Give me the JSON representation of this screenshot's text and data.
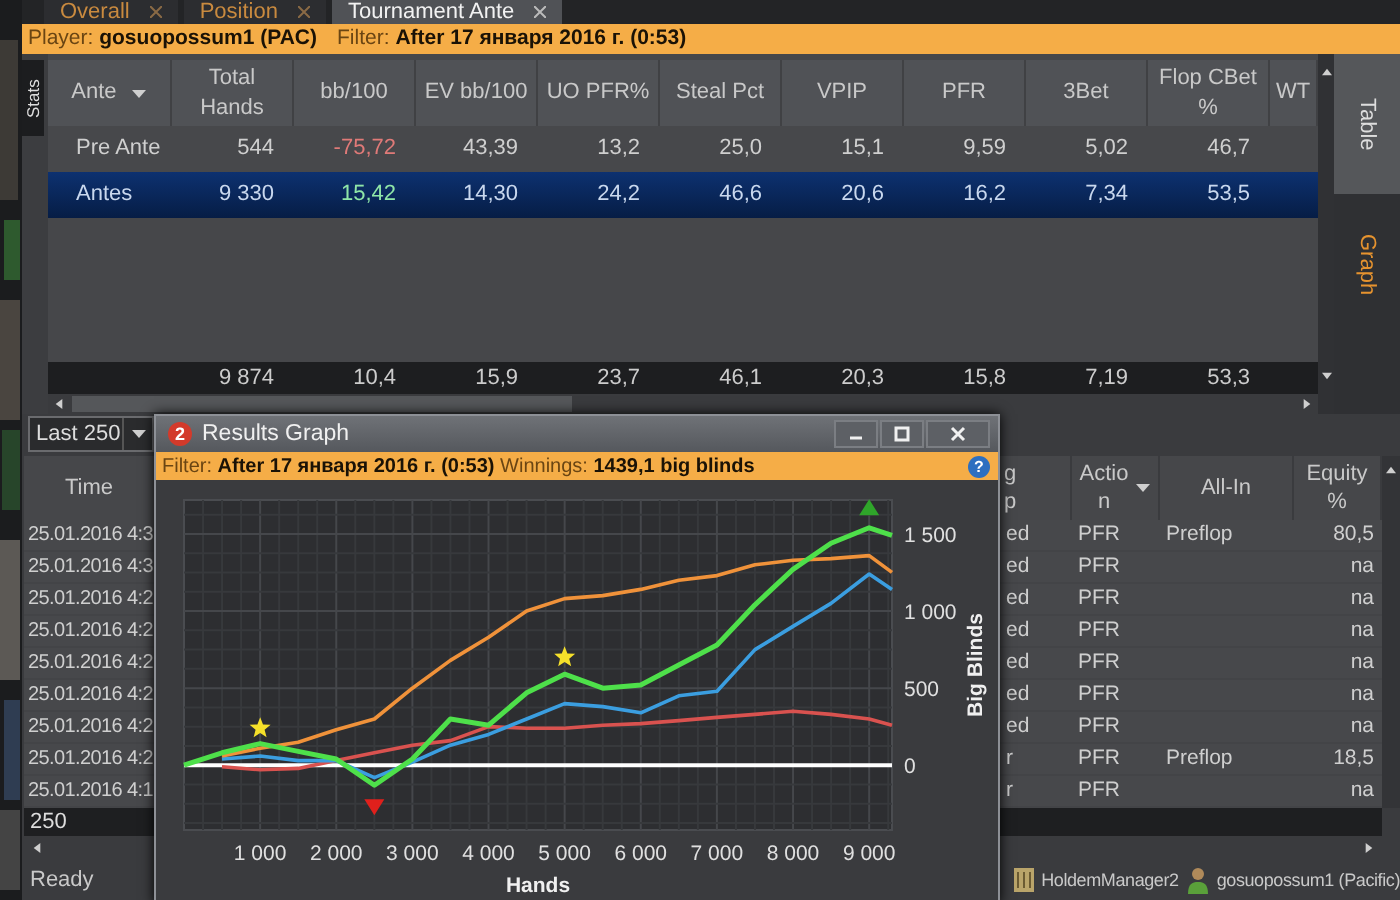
{
  "tabs": [
    {
      "label": "Overall",
      "selected": false
    },
    {
      "label": "Position",
      "selected": false
    },
    {
      "label": "Tournament Ante",
      "selected": true
    }
  ],
  "filter_bar": {
    "player": "Player: **gosuopossum1 (PAC)**",
    "filter": "Filter: **After 17 января 2016 г. (0:53)**"
  },
  "stats_tab": "Stats",
  "stats_table": {
    "columns": [
      {
        "label": "Ante",
        "dropdown": true
      },
      {
        "label": "Total\nHands",
        "dropdown": false
      },
      {
        "label": "bb/100",
        "dropdown": false
      },
      {
        "label": "EV bb/100",
        "dropdown": false
      },
      {
        "label": "UO PFR%",
        "dropdown": false
      },
      {
        "label": "Steal Pct",
        "dropdown": false
      },
      {
        "label": "VPIP",
        "dropdown": false
      },
      {
        "label": "PFR",
        "dropdown": false
      },
      {
        "label": "3Bet",
        "dropdown": false
      },
      {
        "label": "Flop CBet\n%",
        "dropdown": false
      },
      {
        "label": "WT",
        "dropdown": false
      }
    ],
    "rows": [
      {
        "cells": [
          "Pre Ante",
          "544",
          "-75,72",
          "43,39",
          "13,2",
          "25,0",
          "15,1",
          "9,59",
          "5,02",
          "46,7"
        ],
        "selected": false,
        "bb_negative": true
      },
      {
        "cells": [
          "Antes",
          "9 330",
          "15,42",
          "14,30",
          "24,2",
          "46,6",
          "20,6",
          "16,2",
          "7,34",
          "53,5"
        ],
        "selected": true,
        "bb_negative": false
      }
    ],
    "totals": [
      "9 874",
      "10,4",
      "15,9",
      "23,7",
      "46,1",
      "20,3",
      "15,8",
      "7,19",
      "53,3"
    ]
  },
  "side_tabs": [
    {
      "label": "Table",
      "selected": false
    },
    {
      "label": "Graph",
      "selected": true
    }
  ],
  "hands_filter": {
    "value": "Last 250"
  },
  "hands_table": {
    "columns": [
      {
        "label": "Time",
        "dropdown": false
      },
      {
        "label": "g\np",
        "dropdown": false
      },
      {
        "label": "Actio\nn",
        "dropdown": true
      },
      {
        "label": "All-In",
        "dropdown": false
      },
      {
        "label": "Equity\n%",
        "dropdown": false
      }
    ],
    "rows": [
      {
        "time": "25.01.2016 4:3",
        "column_2": "ed",
        "action": "PFR",
        "all_in": "Preflop",
        "equity": "80,5"
      },
      {
        "time": "25.01.2016 4:3",
        "column_2": "ed",
        "action": "PFR",
        "equity": "na"
      },
      {
        "time": "25.01.2016 4:2",
        "column_2": "ed",
        "action": "PFR",
        "equity": "na"
      },
      {
        "time": "25.01.2016 4:2",
        "column_2": "ed",
        "action": "PFR",
        "equity": "na"
      },
      {
        "time": "25.01.2016 4:2",
        "column_2": "ed",
        "action": "PFR",
        "equity": "na"
      },
      {
        "time": "25.01.2016 4:2",
        "column_2": "ed",
        "action": "PFR",
        "equity": "na"
      },
      {
        "time": "25.01.2016 4:2",
        "column_2": "ed",
        "action": "PFR",
        "equity": "na"
      },
      {
        "time": "25.01.2016 4:2",
        "column_2": "r",
        "action": "PFR",
        "all_in": "Preflop",
        "equity": "18,5"
      },
      {
        "time": "25.01.2016 4:1",
        "column_2": "r",
        "action": "PFR",
        "equity": "na"
      }
    ],
    "footer_count": "250"
  },
  "status_bar": {
    "text": "Ready",
    "app": "HoldemManager2",
    "player": "gosuopossum1 (Pacific)"
  },
  "graph_window": {
    "badge": "2",
    "title": "Results Graph",
    "info": "Filter: **After 17 января 2016 г. (0:53)** Winnings: **1439,1 big blinds**",
    "help": "?",
    "chart_data": {
      "type": "line",
      "grid": true,
      "xlabel": "Hands",
      "ylabel": "Big Blinds",
      "x": [
        0,
        500,
        1000,
        1500,
        2000,
        2500,
        3000,
        3500,
        4000,
        4500,
        5000,
        5500,
        6000,
        6500,
        7000,
        7500,
        8000,
        8500,
        9000,
        9300
      ],
      "series": [
        {
          "color": "#4ee04a",
          "values": [
            0,
            80,
            140,
            90,
            40,
            -130,
            40,
            300,
            260,
            470,
            590,
            500,
            520,
            650,
            780,
            1040,
            1270,
            1440,
            1540,
            1490
          ]
        },
        {
          "color": "#f0923a",
          "values": [
            null,
            60,
            110,
            150,
            230,
            300,
            500,
            680,
            830,
            1000,
            1080,
            1100,
            1140,
            1200,
            1230,
            1300,
            1330,
            1340,
            1360,
            1250
          ]
        },
        {
          "color": "#3b9ee0",
          "values": [
            null,
            40,
            60,
            30,
            30,
            -80,
            20,
            130,
            200,
            300,
            400,
            380,
            340,
            450,
            480,
            750,
            900,
            1050,
            1240,
            1140
          ]
        },
        {
          "color": "#d9524f",
          "values": [
            null,
            -10,
            -30,
            -20,
            30,
            80,
            130,
            160,
            250,
            240,
            240,
            260,
            270,
            290,
            310,
            330,
            350,
            330,
            300,
            260
          ]
        },
        {
          "color": "#f5e02a",
          "type": "scatter",
          "marker": "star",
          "values": [
            null,
            null,
            240,
            null,
            null,
            null,
            null,
            null,
            null,
            null,
            700,
            null,
            null,
            null,
            null,
            null,
            null,
            null,
            null,
            null
          ]
        },
        {
          "color": "#e0201c",
          "type": "scatter",
          "marker": "triangle-down",
          "values": [
            null,
            null,
            null,
            null,
            null,
            -260,
            null,
            null,
            null,
            null,
            null,
            null,
            null,
            null,
            null,
            null,
            null,
            null,
            null,
            null
          ]
        },
        {
          "color": "#2fa52a",
          "type": "scatter",
          "marker": "triangle-up",
          "values": [
            null,
            null,
            null,
            null,
            null,
            null,
            null,
            null,
            null,
            null,
            null,
            null,
            null,
            null,
            null,
            null,
            null,
            null,
            1660,
            null
          ]
        }
      ],
      "xlim": [
        0,
        9300
      ],
      "ylim": [
        -420,
        1720
      ],
      "xticks": [
        {
          "value": 1000,
          "label": "1 000"
        },
        {
          "value": 2000,
          "label": "2 000"
        },
        {
          "value": 3000,
          "label": "3 000"
        },
        {
          "value": 4000,
          "label": "4 000"
        },
        {
          "value": 5000,
          "label": "5 000"
        },
        {
          "value": 6000,
          "label": "6 000"
        },
        {
          "value": 7000,
          "label": "7 000"
        },
        {
          "value": 8000,
          "label": "8 000"
        },
        {
          "value": 9000,
          "label": "9 000"
        }
      ],
      "yticks": [
        0,
        500,
        {
          "value": 1000,
          "label": "1 000"
        },
        {
          "value": 1500,
          "label": "1 500"
        }
      ]
    }
  }
}
